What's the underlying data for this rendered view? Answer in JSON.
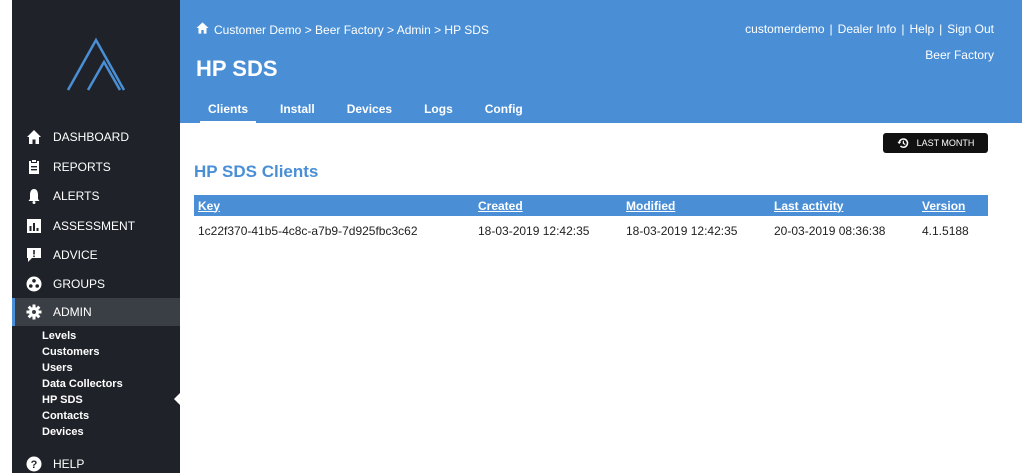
{
  "header": {
    "breadcrumb": "Customer Demo > Beer Factory > Admin > HP SDS",
    "links": [
      "customerdemo",
      "Dealer Info",
      "Help",
      "Sign Out"
    ],
    "organization": "Beer Factory",
    "title": "HP SDS",
    "tabs": [
      "Clients",
      "Install",
      "Devices",
      "Logs",
      "Config"
    ],
    "active_tab": "Clients"
  },
  "sidebar": {
    "items": [
      {
        "label": "DASHBOARD",
        "icon": "home-icon"
      },
      {
        "label": "REPORTS",
        "icon": "clipboard-icon"
      },
      {
        "label": "ALERTS",
        "icon": "bell-icon"
      },
      {
        "label": "ASSESSMENT",
        "icon": "bar-chart-icon"
      },
      {
        "label": "ADVICE",
        "icon": "exclamation-speech-icon"
      },
      {
        "label": "GROUPS",
        "icon": "groups-icon"
      },
      {
        "label": "ADMIN",
        "icon": "gear-icon"
      },
      {
        "label": "HELP",
        "icon": "help-icon"
      }
    ],
    "admin_subitems": [
      "Levels",
      "Customers",
      "Users",
      "Data Collectors",
      "HP SDS",
      "Contacts",
      "Devices"
    ],
    "active_subitem": "HP SDS"
  },
  "main": {
    "period_button": "LAST MONTH",
    "section_title": "HP SDS Clients",
    "table": {
      "columns": [
        "Key",
        "Created",
        "Modified",
        "Last activity",
        "Version"
      ],
      "rows": [
        [
          "1c22f370-41b5-4c8c-a7b9-7d925fbc3c62",
          "18-03-2019 12:42:35",
          "18-03-2019 12:42:35",
          "20-03-2019 08:36:38",
          "4.1.5188"
        ]
      ]
    }
  },
  "colors": {
    "accent": "#4a8fd6",
    "sidebar_bg": "#1f2329",
    "button_bg": "#111111"
  }
}
